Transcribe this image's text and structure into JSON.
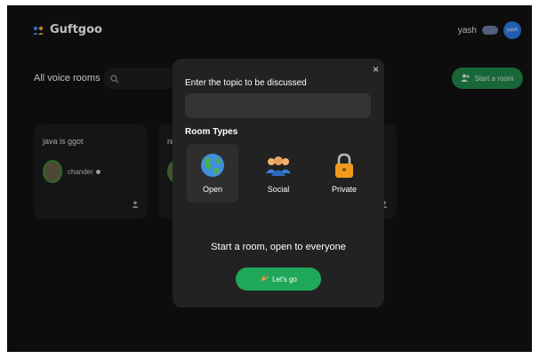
{
  "app": {
    "name": "Guftgoo"
  },
  "user": {
    "name": "yash",
    "avatar_text": "yash"
  },
  "header": {
    "title": "All voice rooms",
    "start_room_label": "Start a room"
  },
  "rooms": [
    {
      "title": "java is ggot",
      "speaker": "chander",
      "people_icon": "person-icon"
    },
    {
      "title": "re",
      "speaker": "",
      "people_icon": "person-icon"
    },
    {
      "title": "",
      "speaker": "",
      "people_icon": "person-icon"
    }
  ],
  "modal": {
    "close_label": "×",
    "topic_label": "Enter the topic to be discussed",
    "topic_value": "",
    "types_label": "Room Types",
    "types": [
      {
        "label": "Open",
        "icon": "globe-icon",
        "selected": true
      },
      {
        "label": "Social",
        "icon": "people-icon",
        "selected": false
      },
      {
        "label": "Private",
        "icon": "lock-icon",
        "selected": false
      }
    ],
    "description": "Start a room, open to everyone",
    "go_label": "Let's go"
  },
  "colors": {
    "background": "#121212",
    "modal": "#222222",
    "accent_green": "#1fa85a",
    "avatar_blue": "#2d7be8"
  }
}
